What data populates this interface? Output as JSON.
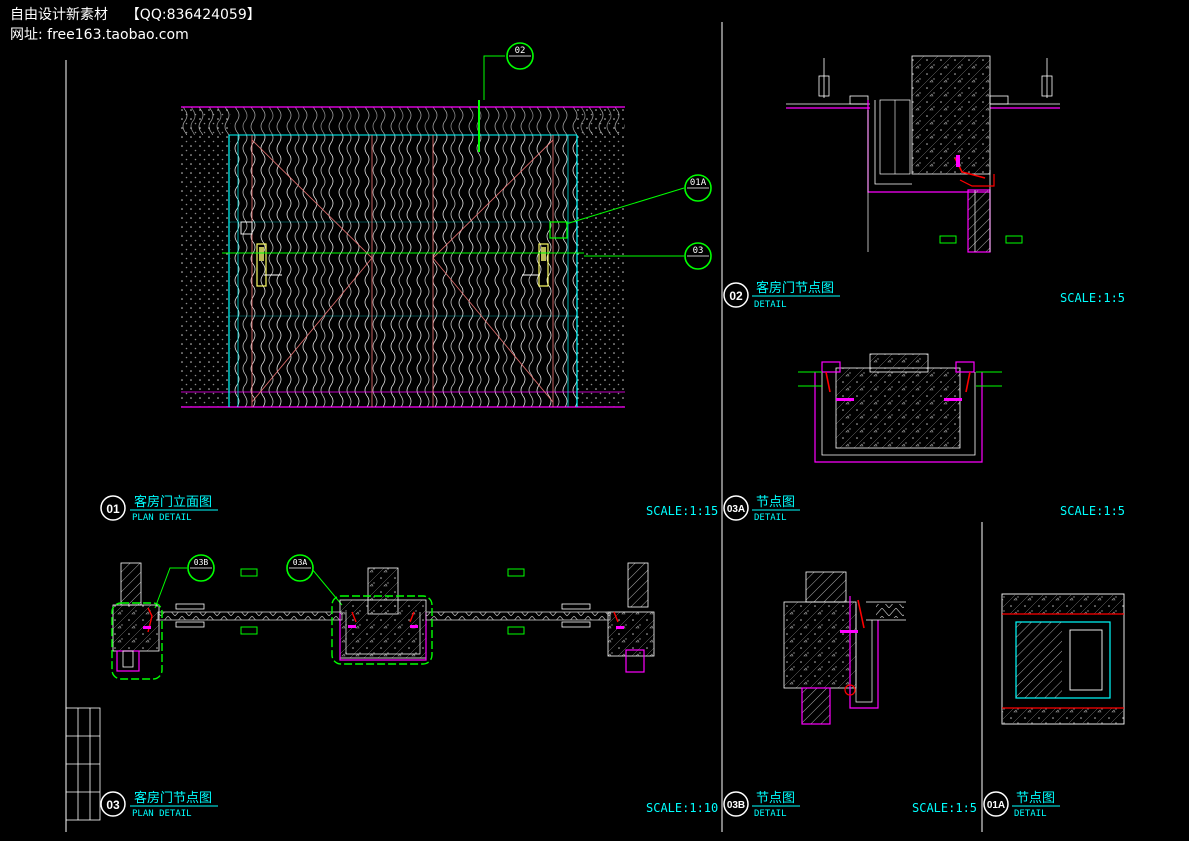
{
  "watermark": {
    "line1_name": "自由设计新素材",
    "line1_qq": "【QQ:836424059】",
    "line2": "网址: free163.taobao.com"
  },
  "colors": {
    "background": "#000000",
    "cyan": "#00ffff",
    "green": "#00ff00",
    "magenta": "#ff00ff",
    "white": "#ffffff",
    "red": "#ff0000",
    "yellow": "#ffff00",
    "grey": "#bbbbbb",
    "pink": "#ff8080"
  },
  "callouts": {
    "c02": "02",
    "c01a": "01A",
    "c03": "03",
    "c03b": "03B",
    "c03a": "03A"
  },
  "titles": {
    "t01": {
      "num": "01",
      "title": "客房门立面图",
      "sub": "PLAN DETAIL",
      "scale": "SCALE:1:15"
    },
    "t02": {
      "num": "02",
      "title": "客房门节点图",
      "sub": "DETAIL",
      "scale": "SCALE:1:5"
    },
    "t03a": {
      "num": "03A",
      "title": "节点图",
      "sub": "DETAIL",
      "scale": "SCALE:1:5"
    },
    "t03": {
      "num": "03",
      "title": "客房门节点图",
      "sub": "PLAN DETAIL",
      "scale": "SCALE:1:10"
    },
    "t03b": {
      "num": "03B",
      "title": "节点图",
      "sub": "DETAIL",
      "scale": "SCALE:1:5"
    },
    "t01a": {
      "num": "01A",
      "title": "节点图",
      "sub": "DETAIL"
    }
  }
}
